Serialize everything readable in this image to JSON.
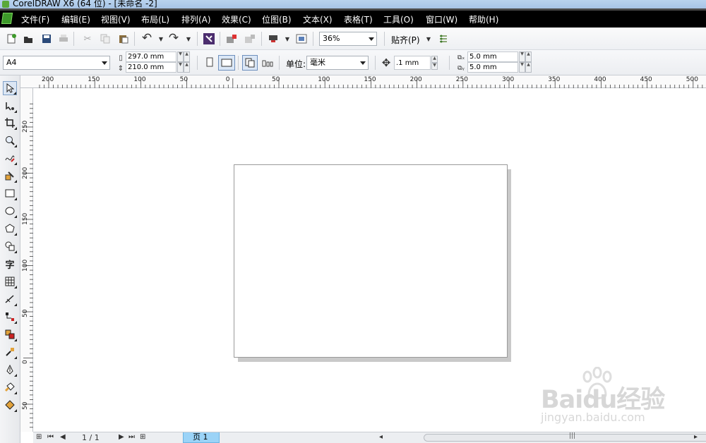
{
  "window": {
    "title": "CorelDRAW X6 (64 位) - [未命名 -2]"
  },
  "menu": [
    {
      "label": "文件(F)"
    },
    {
      "label": "编辑(E)"
    },
    {
      "label": "视图(V)"
    },
    {
      "label": "布局(L)"
    },
    {
      "label": "排列(A)"
    },
    {
      "label": "效果(C)"
    },
    {
      "label": "位图(B)"
    },
    {
      "label": "文本(X)"
    },
    {
      "label": "表格(T)"
    },
    {
      "label": "工具(O)"
    },
    {
      "label": "窗口(W)"
    },
    {
      "label": "帮助(H)"
    }
  ],
  "toolbar": {
    "zoom_value": "36%",
    "snap_label": "贴齐(P)",
    "icons": [
      "new-icon",
      "open-icon",
      "save-icon",
      "print-icon",
      "cut-icon",
      "copy-icon",
      "paste-icon",
      "undo-icon",
      "redo-icon",
      "search-content-icon",
      "import-icon",
      "export-icon",
      "publish-icon",
      "app-launcher-icon",
      "options-icon"
    ]
  },
  "propertybar": {
    "page_size": "A4",
    "width": "297.0 mm",
    "height": "210.0 mm",
    "unit_label": "单位:",
    "unit_value": "毫米",
    "nudge": ".1 mm",
    "dup_x": "5.0 mm",
    "dup_y": "5.0 mm"
  },
  "rulers": {
    "horizontal": [
      "200",
      "150",
      "100",
      "50",
      "0",
      "50",
      "100",
      "150",
      "200",
      "250",
      "300",
      "350",
      "400",
      "450",
      "500"
    ],
    "vertical": [
      "250",
      "200",
      "150",
      "100",
      "50",
      "0",
      "50"
    ]
  },
  "toolbox": [
    "pick-tool",
    "shape-tool",
    "crop-tool",
    "zoom-tool",
    "freehand-tool",
    "smart-fill-tool",
    "rectangle-tool",
    "ellipse-tool",
    "polygon-tool",
    "basic-shapes-tool",
    "text-tool",
    "table-tool",
    "dimension-tool",
    "connector-tool",
    "blend-tool",
    "eyedropper-tool",
    "outline-tool",
    "fill-tool",
    "interactive-fill-tool"
  ],
  "toolbox_glyphs": {
    "text": "字"
  },
  "status": {
    "page_counter": "1 / 1",
    "page_tab": "页 1"
  },
  "watermark": {
    "brand": "Baidu经验",
    "url": "jingyan.baidu.com"
  }
}
